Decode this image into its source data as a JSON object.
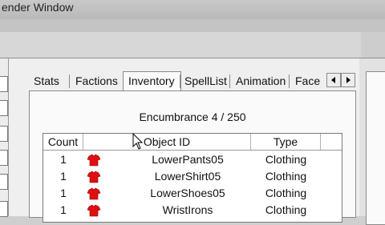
{
  "window": {
    "title": "ender Window"
  },
  "tabs": [
    {
      "label": "Stats"
    },
    {
      "label": "Factions"
    },
    {
      "label": "Inventory",
      "active": true
    },
    {
      "label": "SpellList"
    },
    {
      "label": "Animation"
    },
    {
      "label": "Face"
    }
  ],
  "tab_scroll": {
    "left_icon": "triangle-left-icon",
    "right_icon": "triangle-right-icon"
  },
  "encumbrance": {
    "text": "Encumbrance 4 / 250"
  },
  "table": {
    "columns": [
      "Count",
      "Object ID",
      "Type"
    ],
    "rows": [
      {
        "count": "1",
        "icon": "red-shirt-icon",
        "object_id": "LowerPants05",
        "type": "Clothing"
      },
      {
        "count": "1",
        "icon": "red-shirt-icon",
        "object_id": "LowerShirt05",
        "type": "Clothing"
      },
      {
        "count": "1",
        "icon": "red-shirt-icon",
        "object_id": "LowerShoes05",
        "type": "Clothing"
      },
      {
        "count": "1",
        "icon": "red-shirt-icon",
        "object_id": "WristIrons",
        "type": "Clothing"
      }
    ]
  },
  "colors": {
    "item_icon": "#e01010"
  }
}
